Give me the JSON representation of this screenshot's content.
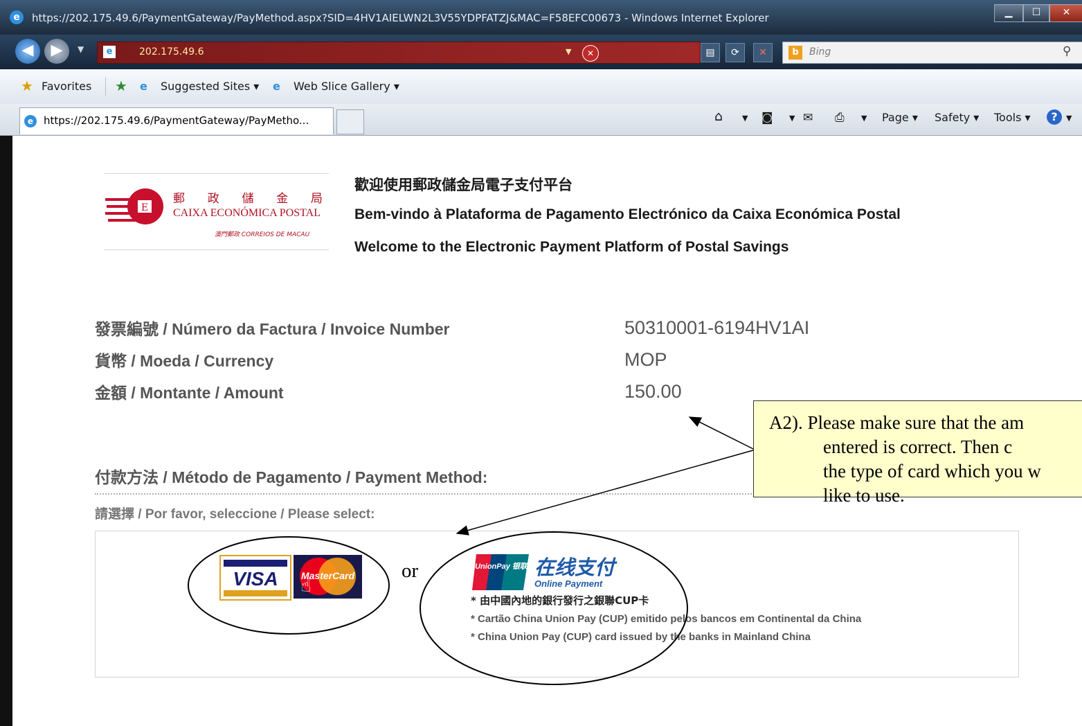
{
  "window": {
    "title": "https://202.175.49.6/PaymentGateway/PayMethod.aspx?SID=4HV1AIELWN2L3V55YDPFATZJ&MAC=F58EFC00673 - Windows Internet Explorer",
    "buttons": [
      "minimize",
      "maximize",
      "close"
    ]
  },
  "navigation": {
    "address": "202.175.49.6",
    "search_placeholder": "Bing"
  },
  "favorites_bar": {
    "favorites_label": "Favorites",
    "suggested_sites": "Suggested Sites",
    "web_slice_gallery": "Web Slice Gallery"
  },
  "tab": {
    "label": "https://202.175.49.6/PaymentGateway/PayMetho..."
  },
  "command_bar": {
    "page": "Page",
    "safety": "Safety",
    "tools": "Tools"
  },
  "brand": {
    "chinese_name": "郵 政 儲 金 局",
    "portuguese_name": "CAIXA ECONÓMICA POSTAL",
    "sub_name": "澳門郵政 CORREIOS DE MACAU"
  },
  "welcome": {
    "zh": "歡迎使用郵政儲金局電子支付平台",
    "pt": "Bem-vindo à Plataforma de Pagamento Electrónico da Caixa Económica Postal",
    "en": "Welcome to the Electronic Payment Platform of Postal Savings"
  },
  "invoice": {
    "invoice_label": "發票編號 / Número da Factura / Invoice Number",
    "invoice_value": "50310001-6194HV1AI",
    "currency_label": "貨幣 / Moeda / Currency",
    "currency_value": "MOP",
    "amount_label": "金額 / Montante / Amount",
    "amount_value": "150.00"
  },
  "payment": {
    "method_label": "付款方法 / Método de Pagamento / Payment Method:",
    "select_label": "請選擇 / Por favor, seleccione / Please select:",
    "visa": "VISA",
    "mastercard": "MasterCard",
    "or": "or",
    "unionpay_logo": "UnionPay 银联",
    "unionpay_title": "在线支付",
    "unionpay_subtitle": "Online Payment",
    "unionpay_note_zh": "* 由中國內地的銀行發行之銀聯CUP卡",
    "unionpay_note_pt": "* Cartão China Union Pay (CUP) emitido pelos bancos em Continental da China",
    "unionpay_note_en": "* China Union Pay (CUP) card issued by the banks in Mainland China"
  },
  "callout": {
    "line1": "A2). Please make sure that the am",
    "line2": "entered is correct.   Then c",
    "line3": "the type of card which you w",
    "line4": "like to use."
  },
  "colors": {
    "visa_blue": "#1a1f71",
    "mastercard_red": "#eb001b",
    "mastercard_orange": "#f79e1b",
    "unionpay_blue": "#1e5aa8",
    "brand_red": "#c8102e",
    "callout_bg": "#ffffcc"
  }
}
